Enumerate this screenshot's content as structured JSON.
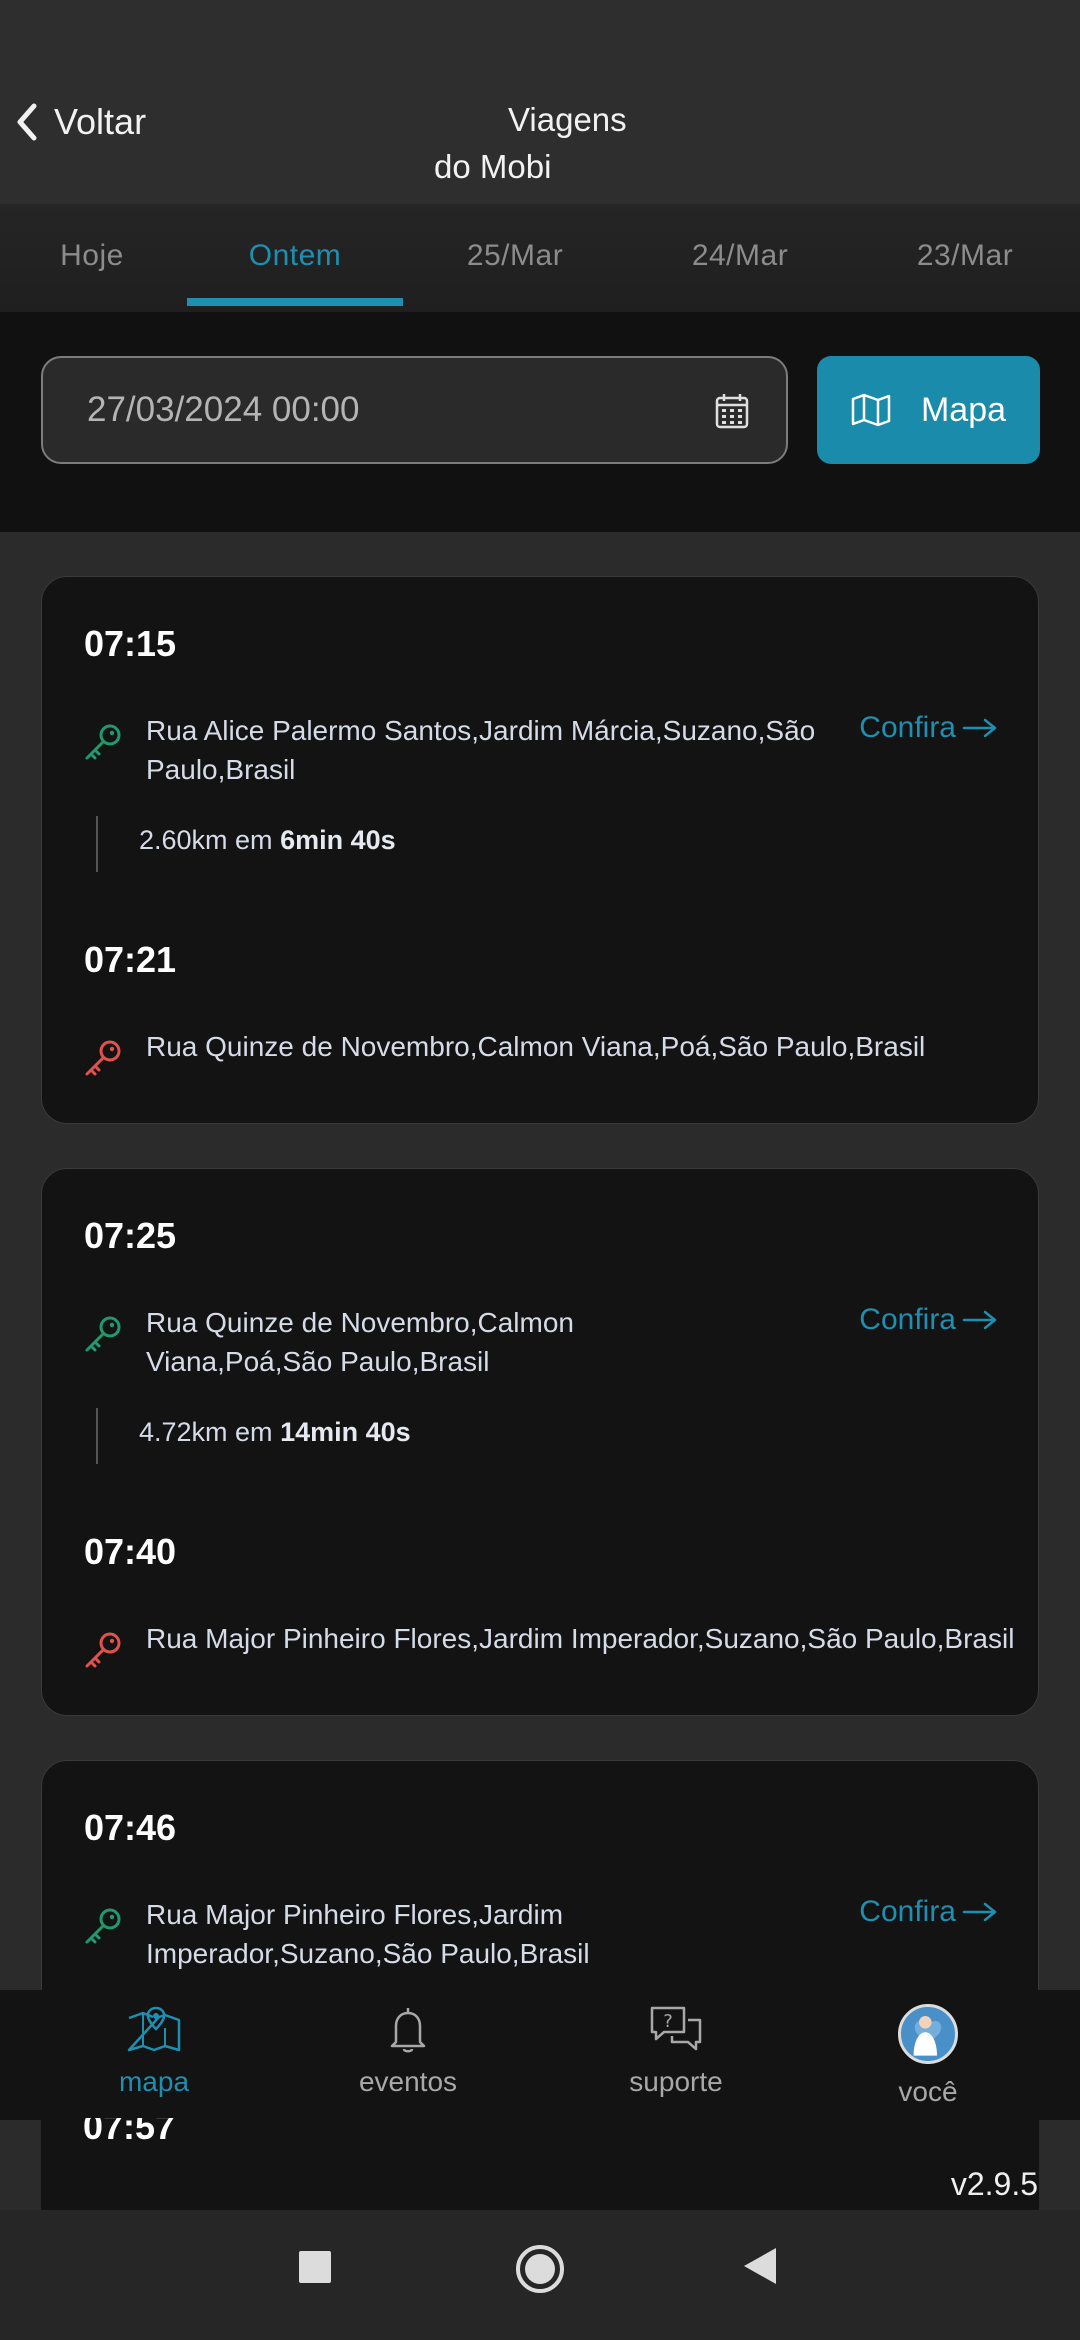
{
  "header": {
    "back_label": "Voltar",
    "title_line1": "Viagens",
    "title_line2": "do Mobi"
  },
  "tabs": [
    {
      "label": "Hoje",
      "active": false
    },
    {
      "label": "Ontem",
      "active": true
    },
    {
      "label": "25/Mar",
      "active": false
    },
    {
      "label": "24/Mar",
      "active": false
    },
    {
      "label": "23/Mar",
      "active": false
    }
  ],
  "filter": {
    "date_value": "27/03/2024 00:00",
    "map_button_label": "Mapa"
  },
  "trips": [
    {
      "start_time": "07:15",
      "start_address": "Rua Alice Palermo Santos,Jardim Márcia,Suzano,São Paulo,Brasil",
      "confira_label": "Confira",
      "distance": "2.60km em",
      "duration": "6min 40s",
      "end_time": "07:21",
      "end_address": "Rua Quinze de Novembro,Calmon Viana,Poá,São Paulo,Brasil"
    },
    {
      "start_time": "07:25",
      "start_address": "Rua Quinze de Novembro,Calmon Viana,Poá,São Paulo,Brasil",
      "confira_label": "Confira",
      "distance": "4.72km em",
      "duration": "14min 40s",
      "end_time": "07:40",
      "end_address": "Rua Major Pinheiro Flores,Jardim Imperador,Suzano,São Paulo,Brasil"
    },
    {
      "start_time": "07:46",
      "start_address": "Rua Major Pinheiro Flores,Jardim Imperador,Suzano,São Paulo,Brasil",
      "confira_label": "Confira"
    }
  ],
  "peek_time": "07:57",
  "bottom_nav": [
    {
      "label": "mapa",
      "icon": "map-pin-icon",
      "active": true
    },
    {
      "label": "eventos",
      "icon": "bell-icon",
      "active": false
    },
    {
      "label": "suporte",
      "icon": "chat-question-icon",
      "active": false
    },
    {
      "label": "você",
      "icon": "avatar",
      "active": false
    }
  ],
  "version": "v2.9.5",
  "colors": {
    "accent": "#1e8fb0",
    "start_key": "#1f9a6e",
    "end_key": "#e0524a"
  }
}
